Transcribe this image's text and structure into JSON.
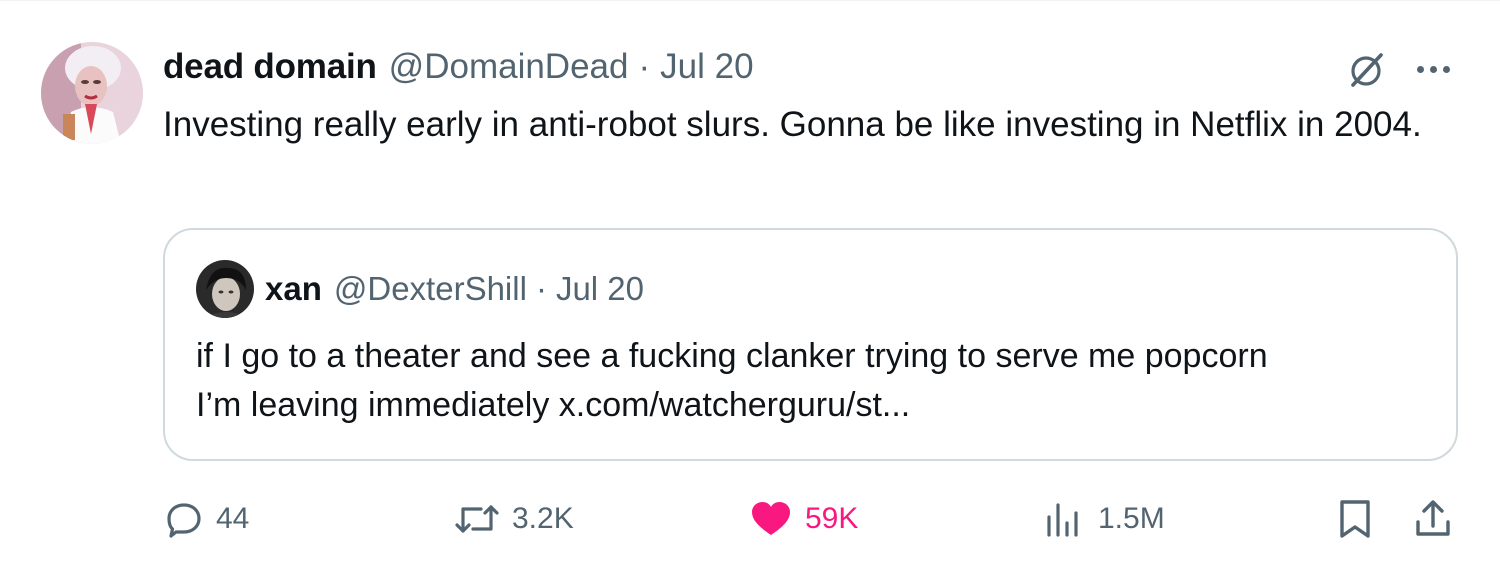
{
  "tweet": {
    "author_name": "dead domain",
    "author_handle": "@DomainDead",
    "separator": "·",
    "date": "Jul 20",
    "text": "Investing really early in anti-robot slurs. Gonna be like investing in Netflix in 2004."
  },
  "quoted_tweet": {
    "author_name": "xan",
    "author_handle": "@DexterShill",
    "separator": "·",
    "date": "Jul 20",
    "text_line1": "if I go to a theater and see a fucking clanker trying to serve me popcorn",
    "text_line2": "I’m leaving immediately x.com/watcherguru/st..."
  },
  "actions": {
    "replies": "44",
    "reposts": "3.2K",
    "likes": "59K",
    "views": "1.5M"
  },
  "icons": {
    "header": [
      "grok-icon",
      "more-options-icon"
    ],
    "actions": [
      "reply-icon",
      "repost-icon",
      "like-icon",
      "views-icon",
      "bookmark-icon",
      "share-icon"
    ]
  },
  "colors": {
    "primary_text": "#0f1419",
    "secondary_text": "#536471",
    "like_active": "#f91880",
    "border": "#cfd9de"
  }
}
